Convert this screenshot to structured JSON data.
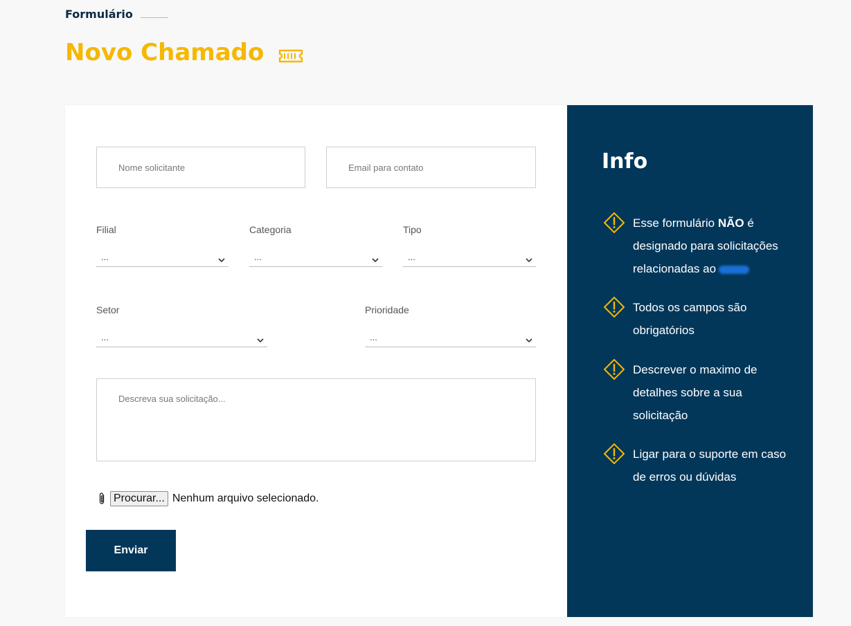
{
  "header": {
    "eyebrow": "Formulário",
    "title": "Novo Chamado",
    "title_icon": "ticket-icon"
  },
  "form": {
    "name_placeholder": "Nome solicitante",
    "email_placeholder": "Email para contato",
    "filial": {
      "label": "Filial",
      "value": "..."
    },
    "categoria": {
      "label": "Categoria",
      "value": "..."
    },
    "tipo": {
      "label": "Tipo",
      "value": "..."
    },
    "setor": {
      "label": "Setor",
      "value": "..."
    },
    "prioridade": {
      "label": "Prioridade",
      "value": "..."
    },
    "description_placeholder": "Descreva sua solicitação...",
    "file_button": "Procurar...",
    "file_status": "Nenhum arquivo selecionado.",
    "submit_label": "Enviar"
  },
  "info": {
    "title": "Info",
    "items": [
      {
        "prefix": "Esse formulário ",
        "strong": "NÃO",
        "suffix": " é designado para solicitações relacionadas ao"
      },
      {
        "text": "Todos os campos são obrigatórios"
      },
      {
        "text": "Descrever o maximo de detalhes sobre a sua solicitação"
      },
      {
        "text": "Ligar para o suporte em caso de erros ou dúvidas"
      }
    ]
  },
  "colors": {
    "accent": "#f5b800",
    "panel": "#03375a",
    "heading": "#0c2a44"
  }
}
